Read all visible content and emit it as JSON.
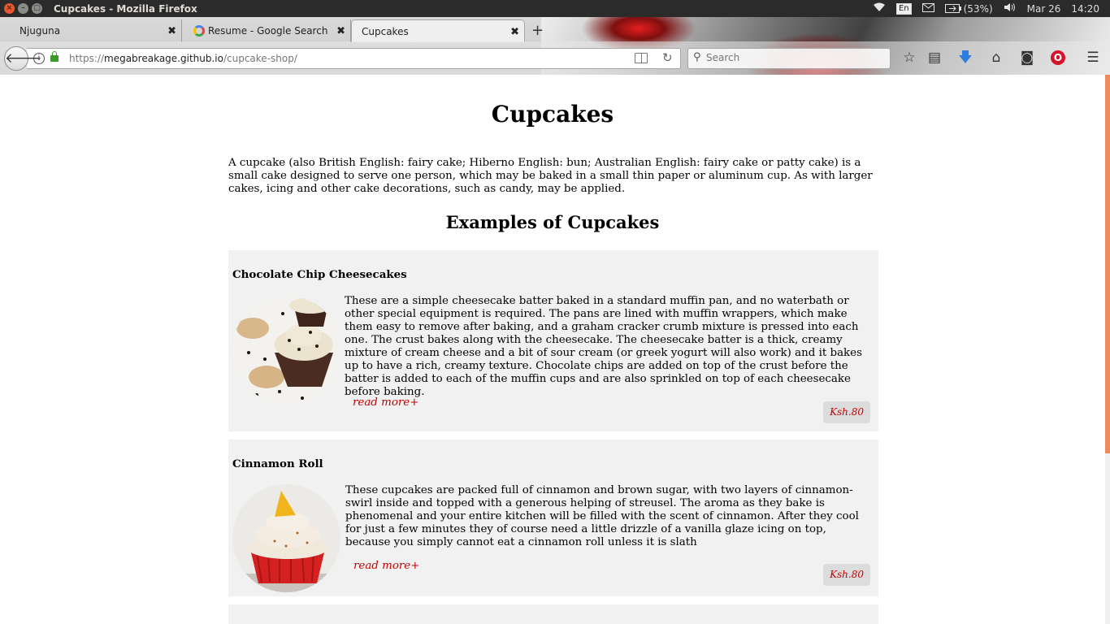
{
  "system": {
    "window_title": "Cupcakes - Mozilla Firefox",
    "keyboard_layout": "En",
    "battery": "(53%)",
    "date": "Mar 26",
    "time": "14:20"
  },
  "browser": {
    "tabs": [
      {
        "label": "Njuguna",
        "active": false
      },
      {
        "label": "Resume - Google Search",
        "active": false
      },
      {
        "label": "Cupcakes",
        "active": true
      }
    ],
    "url_prefix": "https://",
    "url_host": "megabreakage.github.io",
    "url_path": "/cupcake-shop/",
    "search_placeholder": "Search"
  },
  "page": {
    "title": "Cupcakes",
    "intro": "A cupcake (also British English: fairy cake; Hiberno English: bun; Australian English: fairy cake or patty cake) is a small cake designed to serve one person, which may be baked in a small thin paper or aluminum cup. As with larger cakes, icing and other cake decorations, such as candy, may be applied.",
    "examples_heading": "Examples of Cupcakes",
    "items": [
      {
        "name": "Chocolate Chip Cheesecakes",
        "description": "These are a simple cheesecake batter baked in a standard muffin pan, and no waterbath or other special equipment is required. The pans are lined with muffin wrappers, which make them easy to remove after baking, and a graham cracker crumb mixture is pressed into each one. The crust bakes along with the cheesecake. The cheesecake batter is a thick, creamy mixture of cream cheese and a bit of sour cream (or greek yogurt will also work) and it bakes up to have a rich, creamy texture. Chocolate chips are added on top of the crust before the batter is added to each of the muffin cups and are also sprinkled on top of each cheesecake before baking.",
        "read_more": "read more+",
        "price": "Ksh.80"
      },
      {
        "name": "Cinnamon Roll",
        "description": "These cupcakes are packed full of cinnamon and brown sugar, with two layers of cinnamon-swirl inside and topped with a generous helping of streusel. The aroma as they bake is phenomenal and your entire kitchen will be filled with the scent of cinnamon. After they cool for just a few minutes they of course need a little drizzle of a vanilla glaze icing on top, because you simply cannot eat a cinnamon roll unless it is slath",
        "read_more": "read more+",
        "price": "Ksh.80"
      }
    ]
  },
  "colors": {
    "accent_red": "#c00000",
    "card_bg": "#f1f1f1",
    "price_bg": "#dcdcdc",
    "scrollbar": "#ee8a5b"
  }
}
